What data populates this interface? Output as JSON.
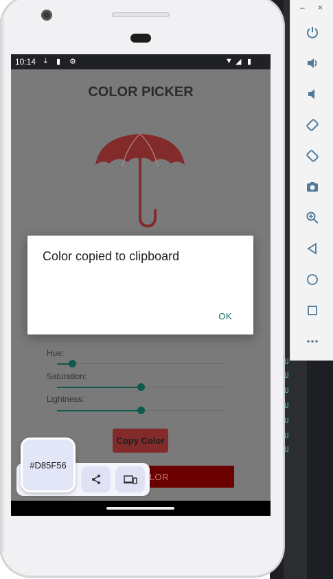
{
  "status_bar": {
    "time": "10:14"
  },
  "app": {
    "title": "COLOR PICKER",
    "umbrella_color": "#832b2b",
    "sliders": [
      {
        "label": "Hue:",
        "value": 0.09
      },
      {
        "label": "Saturation:",
        "value": 0.5
      },
      {
        "label": "Lightness:",
        "value": 0.5
      }
    ],
    "copy_button_label": "Copy Color",
    "color_button_label": "OLOR"
  },
  "dialog": {
    "message": "Color copied to clipboard",
    "ok_label": "OK"
  },
  "clipboard_overlay": {
    "copied_text": "#D85F56",
    "share_icon": "share-icon",
    "send_to_device_icon": "devices-icon"
  },
  "emulator_panel": {
    "minimize_label": "–",
    "close_label": "×",
    "buttons": [
      "power-icon",
      "volume-up-icon",
      "volume-down-icon",
      "rotate-left-icon",
      "rotate-right-icon",
      "camera-icon",
      "zoom-icon",
      "back-icon",
      "home-icon",
      "overview-icon",
      "more-icon"
    ]
  },
  "colors": {
    "accent_teal": "#0e5a4c",
    "umbrella": "#832b2b",
    "color_button": "#6b0000"
  }
}
